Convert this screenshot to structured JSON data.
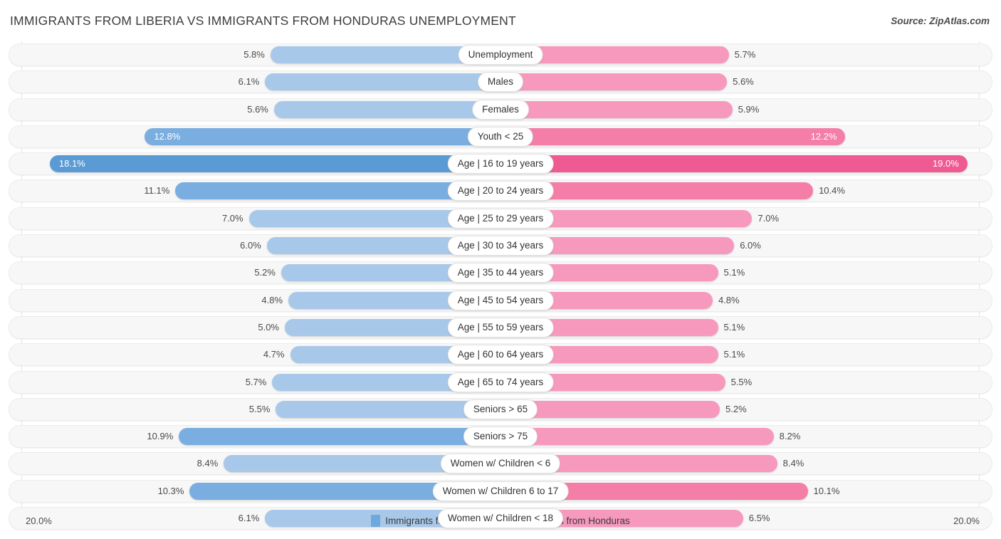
{
  "header": {
    "title": "IMMIGRANTS FROM LIBERIA VS IMMIGRANTS FROM HONDURAS UNEMPLOYMENT",
    "source": "Source: ZipAtlas.com"
  },
  "axis": {
    "left_label": "20.0%",
    "right_label": "20.0%",
    "max": 20.0
  },
  "legend": {
    "items": [
      {
        "label": "Immigrants from Liberia",
        "color": "#6fa8dc"
      },
      {
        "label": "Immigrants from Honduras",
        "color": "#f06292"
      }
    ]
  },
  "colors": {
    "left_light": "#a8c8ea",
    "left_mid": "#7aaee0",
    "left_dark": "#5b9bd5",
    "right_light": "#f799bd",
    "right_mid": "#f47ea8",
    "right_dark": "#ef5a92",
    "track": "#f7f7f7",
    "gridline": "#e3e3e3"
  },
  "chart_data": {
    "type": "bar",
    "orientation": "horizontal-diverging",
    "title": "IMMIGRANTS FROM LIBERIA VS IMMIGRANTS FROM HONDURAS UNEMPLOYMENT",
    "xlabel": "",
    "ylabel": "",
    "xlim": [
      20.0,
      20.0
    ],
    "grid": true,
    "legend_position": "bottom-center",
    "series": [
      {
        "name": "Immigrants from Liberia",
        "side": "left",
        "values": [
          5.8,
          6.1,
          5.6,
          12.8,
          18.1,
          11.1,
          7.0,
          6.0,
          5.2,
          4.8,
          5.0,
          4.7,
          5.7,
          5.5,
          10.9,
          8.4,
          10.3,
          6.1
        ],
        "labels": [
          "5.8%",
          "6.1%",
          "5.6%",
          "12.8%",
          "18.1%",
          "11.1%",
          "7.0%",
          "6.0%",
          "5.2%",
          "4.8%",
          "5.0%",
          "4.7%",
          "5.7%",
          "5.5%",
          "10.9%",
          "8.4%",
          "10.3%",
          "6.1%"
        ]
      },
      {
        "name": "Immigrants from Honduras",
        "side": "right",
        "values": [
          5.7,
          5.6,
          5.9,
          12.2,
          19.0,
          10.4,
          7.0,
          6.0,
          5.1,
          4.8,
          5.1,
          5.1,
          5.5,
          5.2,
          8.2,
          8.4,
          10.1,
          6.5
        ],
        "labels": [
          "5.7%",
          "5.6%",
          "5.9%",
          "12.2%",
          "19.0%",
          "10.4%",
          "7.0%",
          "6.0%",
          "5.1%",
          "4.8%",
          "5.1%",
          "5.1%",
          "5.5%",
          "5.2%",
          "8.2%",
          "8.4%",
          "10.1%",
          "6.5%"
        ]
      }
    ],
    "categories": [
      "Unemployment",
      "Males",
      "Females",
      "Youth < 25",
      "Age | 16 to 19 years",
      "Age | 20 to 24 years",
      "Age | 25 to 29 years",
      "Age | 30 to 34 years",
      "Age | 35 to 44 years",
      "Age | 45 to 54 years",
      "Age | 55 to 59 years",
      "Age | 60 to 64 years",
      "Age | 65 to 74 years",
      "Seniors > 65",
      "Seniors > 75",
      "Women w/ Children < 6",
      "Women w/ Children 6 to 17",
      "Women w/ Children < 18"
    ]
  },
  "rows": [
    {
      "label": "Unemployment",
      "left": 5.8,
      "left_label": "5.8%",
      "right": 5.7,
      "right_label": "5.7%"
    },
    {
      "label": "Males",
      "left": 6.1,
      "left_label": "6.1%",
      "right": 5.6,
      "right_label": "5.6%"
    },
    {
      "label": "Females",
      "left": 5.6,
      "left_label": "5.6%",
      "right": 5.9,
      "right_label": "5.9%"
    },
    {
      "label": "Youth < 25",
      "left": 12.8,
      "left_label": "12.8%",
      "right": 12.2,
      "right_label": "12.2%"
    },
    {
      "label": "Age | 16 to 19 years",
      "left": 18.1,
      "left_label": "18.1%",
      "right": 19.0,
      "right_label": "19.0%"
    },
    {
      "label": "Age | 20 to 24 years",
      "left": 11.1,
      "left_label": "11.1%",
      "right": 10.4,
      "right_label": "10.4%"
    },
    {
      "label": "Age | 25 to 29 years",
      "left": 7.0,
      "left_label": "7.0%",
      "right": 7.0,
      "right_label": "7.0%"
    },
    {
      "label": "Age | 30 to 34 years",
      "left": 6.0,
      "left_label": "6.0%",
      "right": 6.0,
      "right_label": "6.0%"
    },
    {
      "label": "Age | 35 to 44 years",
      "left": 5.2,
      "left_label": "5.2%",
      "right": 5.1,
      "right_label": "5.1%"
    },
    {
      "label": "Age | 45 to 54 years",
      "left": 4.8,
      "left_label": "4.8%",
      "right": 4.8,
      "right_label": "4.8%"
    },
    {
      "label": "Age | 55 to 59 years",
      "left": 5.0,
      "left_label": "5.0%",
      "right": 5.1,
      "right_label": "5.1%"
    },
    {
      "label": "Age | 60 to 64 years",
      "left": 4.7,
      "left_label": "4.7%",
      "right": 5.1,
      "right_label": "5.1%"
    },
    {
      "label": "Age | 65 to 74 years",
      "left": 5.7,
      "left_label": "5.7%",
      "right": 5.5,
      "right_label": "5.5%"
    },
    {
      "label": "Seniors > 65",
      "left": 5.5,
      "left_label": "5.5%",
      "right": 5.2,
      "right_label": "5.2%"
    },
    {
      "label": "Seniors > 75",
      "left": 10.9,
      "left_label": "10.9%",
      "right": 8.2,
      "right_label": "8.2%"
    },
    {
      "label": "Women w/ Children < 6",
      "left": 8.4,
      "left_label": "8.4%",
      "right": 8.4,
      "right_label": "8.4%"
    },
    {
      "label": "Women w/ Children 6 to 17",
      "left": 10.3,
      "left_label": "10.3%",
      "right": 10.1,
      "right_label": "10.1%"
    },
    {
      "label": "Women w/ Children < 18",
      "left": 6.1,
      "left_label": "6.1%",
      "right": 6.5,
      "right_label": "6.5%"
    }
  ]
}
